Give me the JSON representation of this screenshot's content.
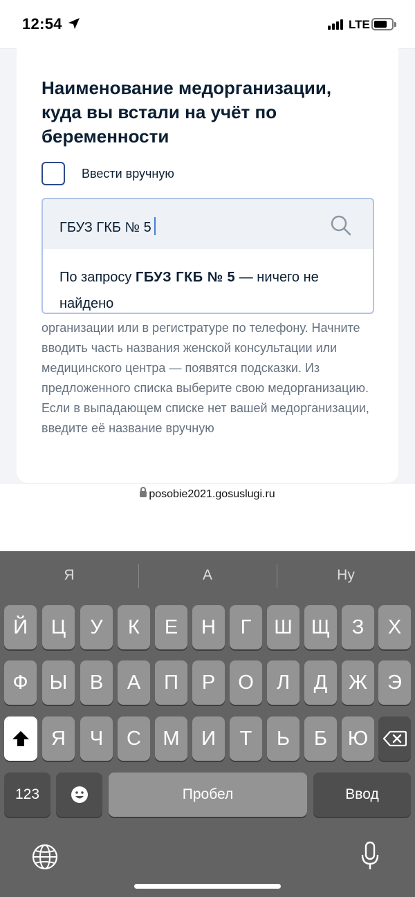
{
  "status_bar": {
    "time": "12:54",
    "network": "LTE"
  },
  "form": {
    "title": "Наименование медорганизации, куда вы встали на учёт по беременности",
    "manual_checkbox_label": "Ввести вручную",
    "search_value": "ГБУЗ ГКБ № 5",
    "dropdown_prefix": "По запросу ",
    "dropdown_query": "ГБУЗ ГКБ № 5",
    "dropdown_suffix": " — ничего не найдено",
    "hint": "организации или в регистратуре по телефону. Начните вводить часть названия женской консультации или медицинского центра — появятся подсказки. Из предложенного списка выберите свою медорганизацию. Если в выпадающем списке нет вашей медорганизации, введите её название вручную"
  },
  "browser": {
    "url": "posobie2021.gosuslugi.ru"
  },
  "keyboard": {
    "suggestions": [
      "Я",
      "А",
      "Ну"
    ],
    "row1": [
      "Й",
      "Ц",
      "У",
      "К",
      "Е",
      "Н",
      "Г",
      "Ш",
      "Щ",
      "З",
      "Х"
    ],
    "row2": [
      "Ф",
      "Ы",
      "В",
      "А",
      "П",
      "Р",
      "О",
      "Л",
      "Д",
      "Ж",
      "Э"
    ],
    "row3": [
      "Я",
      "Ч",
      "С",
      "М",
      "И",
      "Т",
      "Ь",
      "Б",
      "Ю"
    ],
    "numbers_label": "123",
    "space_label": "Пробел",
    "return_label": "Ввод"
  },
  "colors": {
    "accent": "#2d4a8a",
    "keyboard_bg": "#636363",
    "key": "#949494"
  },
  "icons": [
    "location-arrow-icon",
    "signal-icon",
    "battery-icon",
    "search-icon",
    "lock-icon",
    "shift-icon",
    "backspace-icon",
    "emoji-icon",
    "globe-icon",
    "microphone-icon"
  ]
}
